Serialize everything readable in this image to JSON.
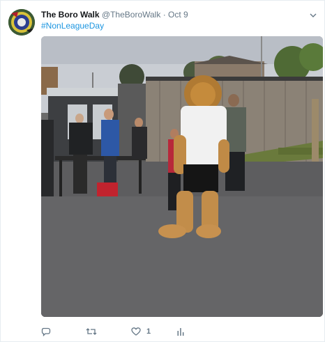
{
  "tweet": {
    "display_name": "The Boro Walk",
    "handle": "@TheBoroWalk",
    "separator": "·",
    "date": "Oct 9",
    "hashtag": "#NonLeagueDay",
    "like_count": "1"
  },
  "icons": {
    "reply": "reply-icon",
    "retweet": "retweet-icon",
    "like": "heart-icon",
    "analytics": "analytics-icon",
    "menu": "chevron-down-icon"
  },
  "colors": {
    "link": "#1b95e0",
    "secondary_text": "#657786",
    "border": "#e6ecf0"
  }
}
